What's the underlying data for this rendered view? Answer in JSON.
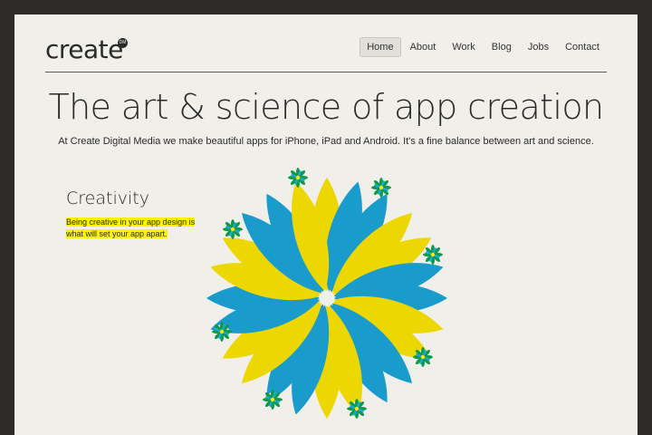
{
  "header": {
    "logo_text": "create",
    "logo_badge": "DM",
    "nav": [
      "Home",
      "About",
      "Work",
      "Blog",
      "Jobs",
      "Contact"
    ],
    "active_nav": "Home"
  },
  "hero": {
    "headline": "The art & science of app creation",
    "tagline": "At Create Digital Media we make beautiful apps for iPhone, iPad and Android. It's a fine balance between art and science."
  },
  "feature": {
    "title": "Creativity",
    "text": "Being creative in your app design is what will set your app apart."
  },
  "colors": {
    "background": "#f1efe9",
    "frame": "#2d2c2b",
    "yellow": "#fae600",
    "blue": "#1aa7e0",
    "green": "#0f9a4a",
    "highlight": "#fbf300"
  },
  "icons": {
    "flower_graphic": "flower-illustration",
    "small_flowers": "small-flower-icon"
  }
}
